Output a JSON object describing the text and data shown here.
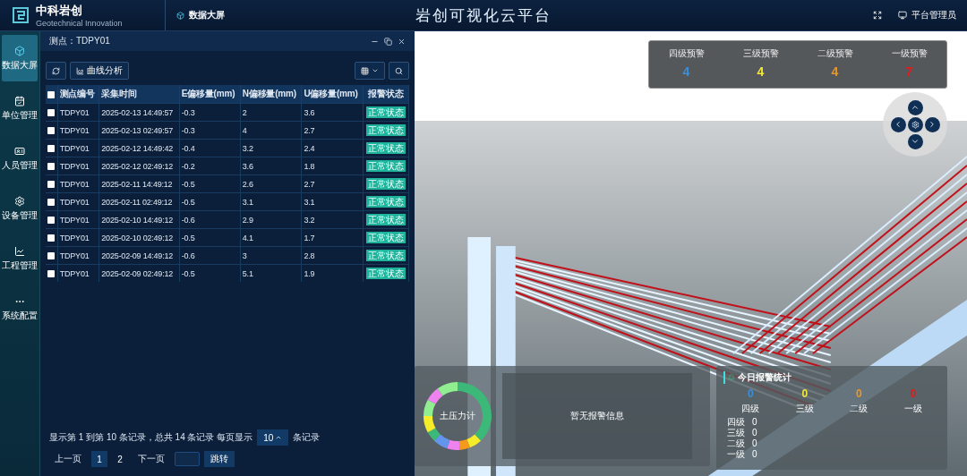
{
  "header": {
    "logo_name": "中科岩创",
    "logo_subtitle": "Geotechnical Innovation",
    "tab": "数据大屏",
    "title": "岩创可视化云平台",
    "user": "平台管理员"
  },
  "sidebar": {
    "items": [
      {
        "label": "数据大屏",
        "selected": true
      },
      {
        "label": "单位管理",
        "selected": false
      },
      {
        "label": "人员管理",
        "selected": false
      },
      {
        "label": "设备管理",
        "selected": false
      },
      {
        "label": "工程管理",
        "selected": false
      },
      {
        "label": "系统配置",
        "selected": false
      }
    ]
  },
  "panel": {
    "title": "测点：TDPY01",
    "toolbar": {
      "curve_button": "曲线分析"
    },
    "table": {
      "header_checked": false,
      "columns": [
        "测点编号",
        "采集时间",
        "E偏移量(mm)",
        "N偏移量(mm)",
        "U偏移量(mm)",
        "报警状态"
      ],
      "rows": [
        {
          "checked": false,
          "cells": [
            "TDPY01",
            "2025-02-13 14:49:57",
            "-0.3",
            "2",
            "3.6"
          ],
          "status": "正常状态"
        },
        {
          "checked": false,
          "cells": [
            "TDPY01",
            "2025-02-13 02:49:57",
            "-0.3",
            "4",
            "2.7"
          ],
          "status": "正常状态"
        },
        {
          "checked": false,
          "cells": [
            "TDPY01",
            "2025-02-12 14:49:42",
            "-0.4",
            "3.2",
            "2.4"
          ],
          "status": "正常状态"
        },
        {
          "checked": false,
          "cells": [
            "TDPY01",
            "2025-02-12 02:49:12",
            "-0.2",
            "3.6",
            "1.8"
          ],
          "status": "正常状态"
        },
        {
          "checked": false,
          "cells": [
            "TDPY01",
            "2025-02-11 14:49:12",
            "-0.5",
            "2.6",
            "2.7"
          ],
          "status": "正常状态"
        },
        {
          "checked": false,
          "cells": [
            "TDPY01",
            "2025-02-11 02:49:12",
            "-0.5",
            "3.1",
            "3.1"
          ],
          "status": "正常状态"
        },
        {
          "checked": false,
          "cells": [
            "TDPY01",
            "2025-02-10 14:49:12",
            "-0.6",
            "2.9",
            "3.2"
          ],
          "status": "正常状态"
        },
        {
          "checked": false,
          "cells": [
            "TDPY01",
            "2025-02-10 02:49:12",
            "-0.5",
            "4.1",
            "1.7"
          ],
          "status": "正常状态"
        },
        {
          "checked": false,
          "cells": [
            "TDPY01",
            "2025-02-09 14:49:12",
            "-0.6",
            "3",
            "2.8"
          ],
          "status": "正常状态"
        },
        {
          "checked": false,
          "cells": [
            "TDPY01",
            "2025-02-09 02:49:12",
            "-0.5",
            "5.1",
            "1.9"
          ],
          "status": "正常状态"
        }
      ]
    },
    "pagination": {
      "summary": "显示第 1 到第 10 条记录，总共 14 条记录 每页显示",
      "page_size": "10",
      "page_size_suffix": "条记录",
      "prev": "上一页",
      "pages": [
        {
          "label": "1",
          "selected": true
        },
        {
          "label": "2",
          "selected": false
        }
      ],
      "next": "下一页",
      "jump": "跳转"
    }
  },
  "warnings": [
    {
      "label": "四级预警",
      "count": "4",
      "color": "#3a8fd8"
    },
    {
      "label": "三级预警",
      "count": "4",
      "color": "#f2e83a"
    },
    {
      "label": "二级预警",
      "count": "4",
      "color": "#e8962a"
    },
    {
      "label": "一级预警",
      "count": "7",
      "color": "#e81818"
    }
  ],
  "sensor_chart": {
    "label": "土压力计"
  },
  "alarm_info": {
    "message": "暂无报警信息"
  },
  "today_stats": {
    "title": "今日报警统计",
    "levels": [
      {
        "label": "四级",
        "count": "0",
        "color": "#3a8fd8"
      },
      {
        "label": "三级",
        "count": "0",
        "color": "#f2e83a"
      },
      {
        "label": "二级",
        "count": "0",
        "color": "#e8962a"
      },
      {
        "label": "一级",
        "count": "0",
        "color": "#e81818"
      }
    ],
    "list": [
      {
        "label": "四级",
        "count": "0"
      },
      {
        "label": "三级",
        "count": "0"
      },
      {
        "label": "二级",
        "count": "0"
      },
      {
        "label": "一级",
        "count": "0"
      }
    ]
  }
}
